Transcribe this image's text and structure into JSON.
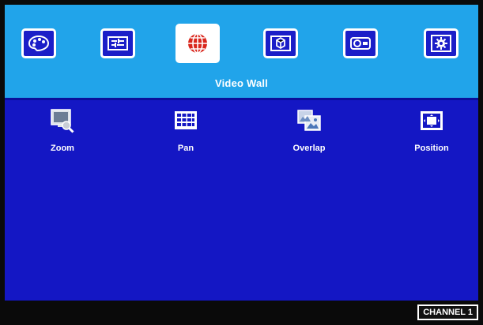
{
  "menu": {
    "title": "Video Wall",
    "tabs": [
      {
        "icon": "palette-icon"
      },
      {
        "icon": "settings-sliders-icon"
      },
      {
        "icon": "globe-icon",
        "active": true
      },
      {
        "icon": "cube-icon"
      },
      {
        "icon": "projector-icon"
      },
      {
        "icon": "gear-icon"
      }
    ]
  },
  "items": [
    {
      "label": "Zoom",
      "icon": "zoom-icon"
    },
    {
      "label": "Pan",
      "icon": "pan-grid-icon"
    },
    {
      "label": "Overlap",
      "icon": "overlap-icon"
    },
    {
      "label": "Position",
      "icon": "position-icon"
    }
  ],
  "status": {
    "channel": "CHANNEL 1"
  },
  "colors": {
    "topbar": "#21a4ea",
    "panel": "#1417c4",
    "active_tab": "#ffffff"
  }
}
